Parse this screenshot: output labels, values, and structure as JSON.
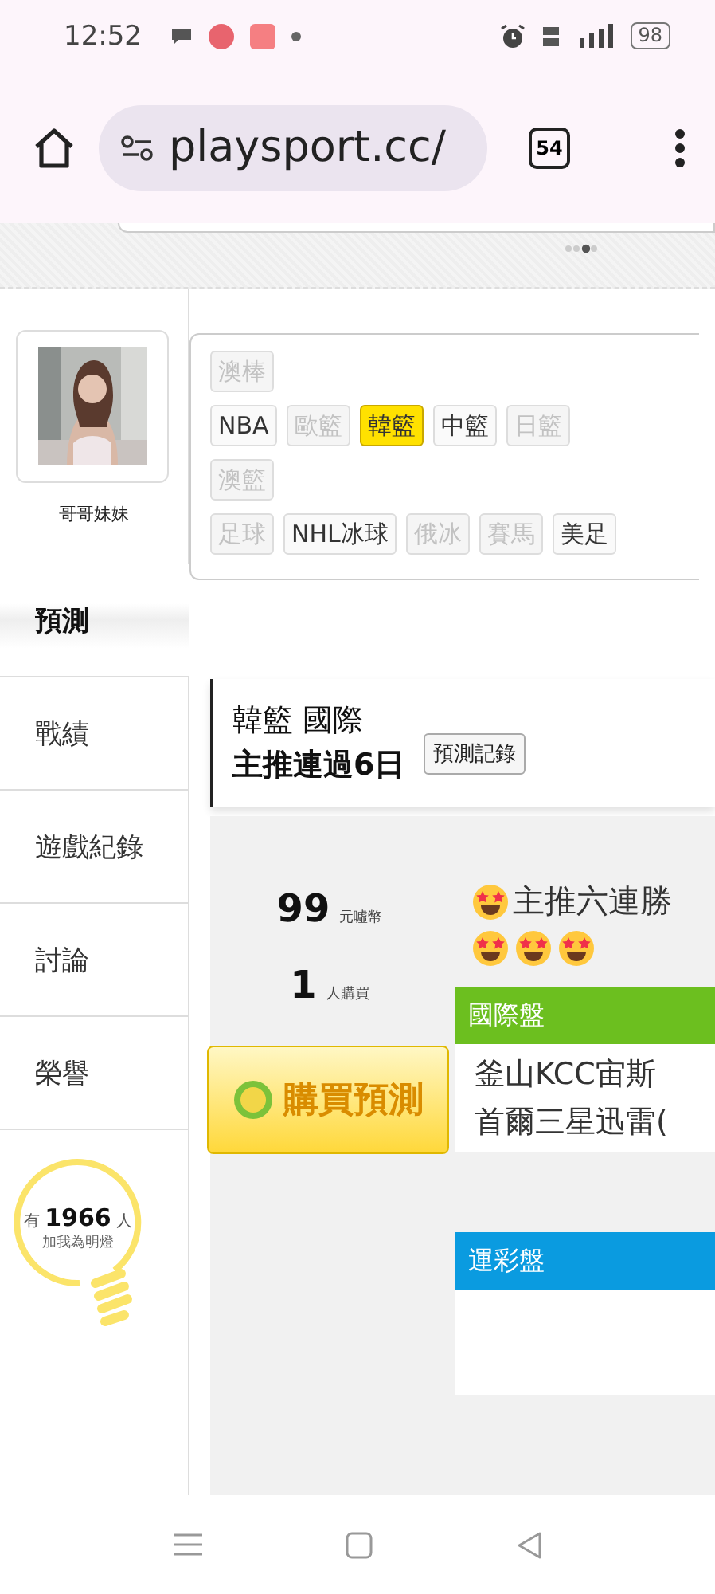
{
  "status_bar": {
    "time": "12:52",
    "battery": "98"
  },
  "browser": {
    "url": "playsport.cc/",
    "tab_count": "54"
  },
  "profile": {
    "name": "哥哥妹妹"
  },
  "sidebar": {
    "items": [
      {
        "label": "預測",
        "selected": true
      },
      {
        "label": "戰績",
        "selected": false
      },
      {
        "label": "遊戲紀錄",
        "selected": false
      },
      {
        "label": "討論",
        "selected": false
      },
      {
        "label": "榮譽",
        "selected": false
      }
    ]
  },
  "fans": {
    "prefix": "有",
    "count": "1966",
    "suffix": "人",
    "caption": "加我為明燈"
  },
  "league_tags": {
    "rows": [
      [
        {
          "label": "澳棒",
          "disabled": true,
          "selected": false
        }
      ],
      [
        {
          "label": "NBA",
          "disabled": false,
          "selected": false
        },
        {
          "label": "歐籃",
          "disabled": true,
          "selected": false
        },
        {
          "label": "韓籃",
          "disabled": false,
          "selected": true
        },
        {
          "label": "中籃",
          "disabled": false,
          "selected": false
        },
        {
          "label": "日籃",
          "disabled": true,
          "selected": false
        }
      ],
      [
        {
          "label": "澳籃",
          "disabled": true,
          "selected": false
        }
      ],
      [
        {
          "label": "足球",
          "disabled": true,
          "selected": false
        },
        {
          "label": "NHL冰球",
          "disabled": false,
          "selected": false
        },
        {
          "label": "俄冰",
          "disabled": true,
          "selected": false
        },
        {
          "label": "賽馬",
          "disabled": true,
          "selected": false
        },
        {
          "label": "美足",
          "disabled": false,
          "selected": false
        }
      ]
    ]
  },
  "header": {
    "title": "韓籃 國際",
    "streak": "主推連過6日",
    "record_button": "預測記錄"
  },
  "price": {
    "amount": "99",
    "unit": "元噓幣"
  },
  "buyers": {
    "count": "1",
    "unit": "人購買"
  },
  "buy_button": "購買預測",
  "headline": "主推六連勝",
  "panels": [
    {
      "title": "國際盤",
      "color": "#6cbf1f",
      "lines": [
        "釜山KCC宙斯",
        "首爾三星迅雷("
      ]
    },
    {
      "title": "運彩盤",
      "color": "#0a9be0"
    }
  ]
}
